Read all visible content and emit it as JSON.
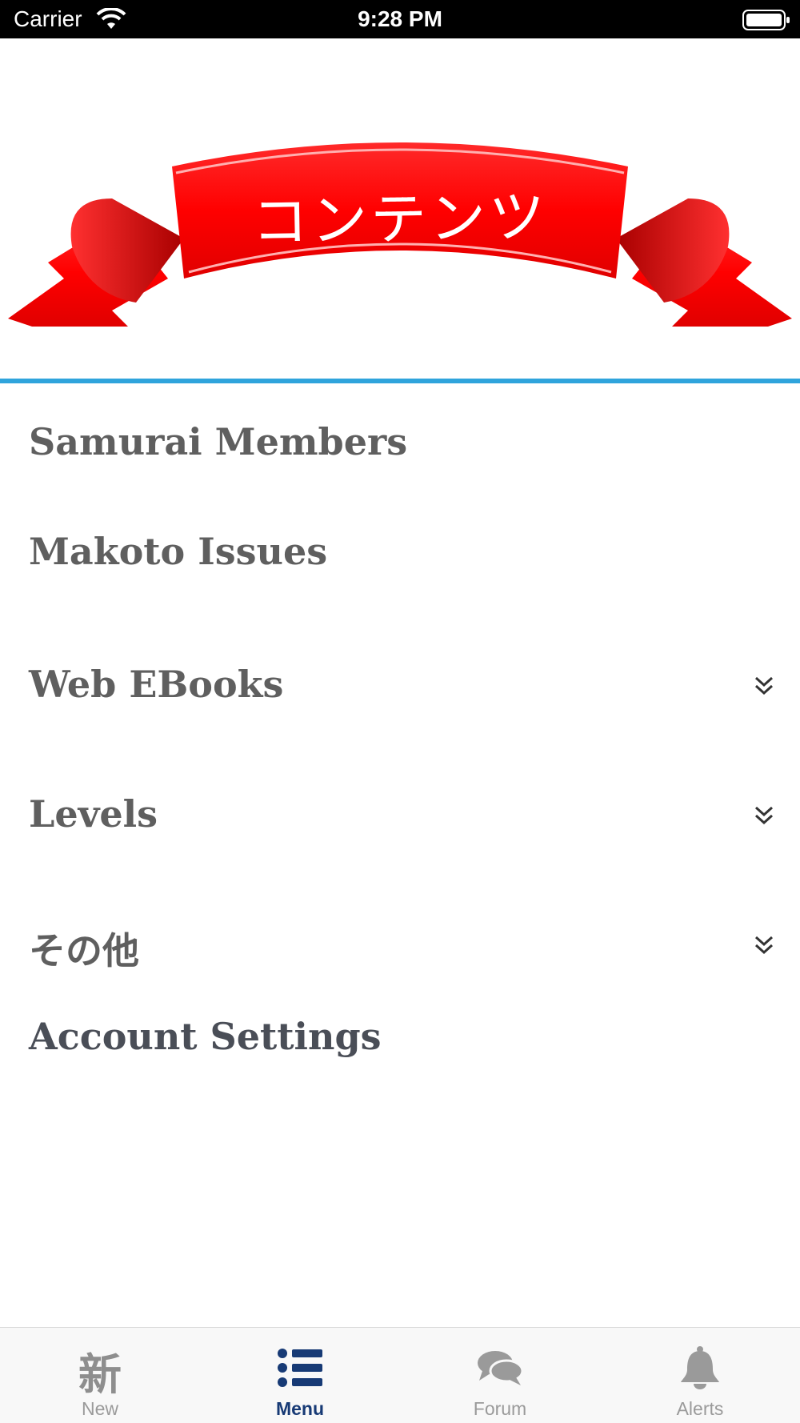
{
  "status_bar": {
    "carrier": "Carrier",
    "time": "9:28 PM"
  },
  "banner": {
    "title": "コンテンツ",
    "ribbon_color": "#ff0000",
    "rule_color": "#2fa4dc"
  },
  "menu": {
    "items": [
      {
        "label": "Samurai Members",
        "expandable": false
      },
      {
        "label": "Makoto Issues",
        "expandable": false
      },
      {
        "label": "Web EBooks",
        "expandable": true
      },
      {
        "label": "Levels",
        "expandable": true
      },
      {
        "label": "その他",
        "expandable": true
      },
      {
        "label": "Account Settings",
        "expandable": false
      }
    ]
  },
  "tab_bar": {
    "tabs": [
      {
        "label": "New",
        "icon": "kanji-new-icon",
        "glyph": "新",
        "active": false
      },
      {
        "label": "Menu",
        "icon": "list-icon",
        "active": true
      },
      {
        "label": "Forum",
        "icon": "chat-bubbles-icon",
        "active": false
      },
      {
        "label": "Alerts",
        "icon": "bell-icon",
        "active": false
      }
    ],
    "active_color": "#173a75",
    "inactive_color": "#9a9a9a"
  }
}
